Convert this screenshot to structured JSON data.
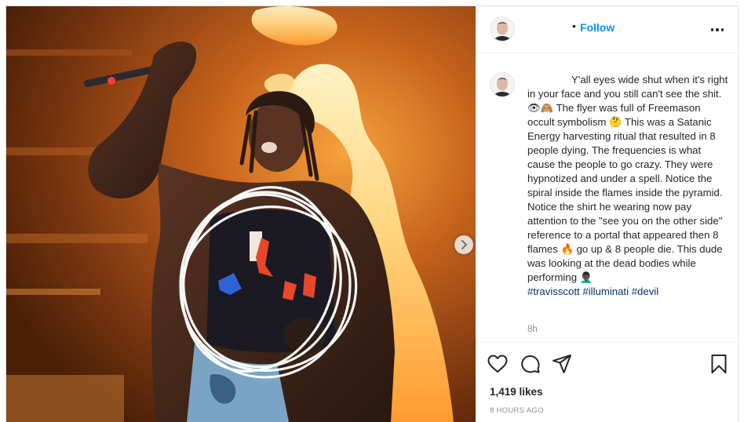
{
  "post": {
    "header": {
      "username": "",
      "separator": "•",
      "follow_label": "Follow",
      "more_icon": "more-horizontal-icon"
    },
    "photo": {
      "next_icon": "chevron-right-icon"
    },
    "caption": {
      "text": "Y'all eyes wide shut when it's right in your face and you still can't see the shit. 👁🙈 The flyer was full of Freemason occult symbolism 🤔 This was a Satanic Energy harvesting ritual that resulted in 8 people dying. The frequencies is what cause the people to go crazy. They were hypnotized and under a spell. Notice the spiral inside the flames inside the pyramid. Notice the shirt he wearing now pay attention to the \"see you on the other side\" reference to a portal that appeared then 8 flames 🔥 go up & 8 people die. This dude was looking at the dead bodies while performing 🤦🏿‍♂️",
      "hashtags": [
        "#travisscott",
        "#illuminati",
        "#devil"
      ],
      "time_ago": "8h"
    },
    "actions": {
      "icons": [
        "heart-icon",
        "comment-icon",
        "share-icon",
        "bookmark-icon"
      ]
    },
    "likes": "1,419 likes",
    "timestamp": "8 HOURS AGO",
    "colors": {
      "accent": "#0095f6",
      "hashtag": "#00376b",
      "muted": "#8e8e8e",
      "border": "#dbdbdb"
    }
  }
}
